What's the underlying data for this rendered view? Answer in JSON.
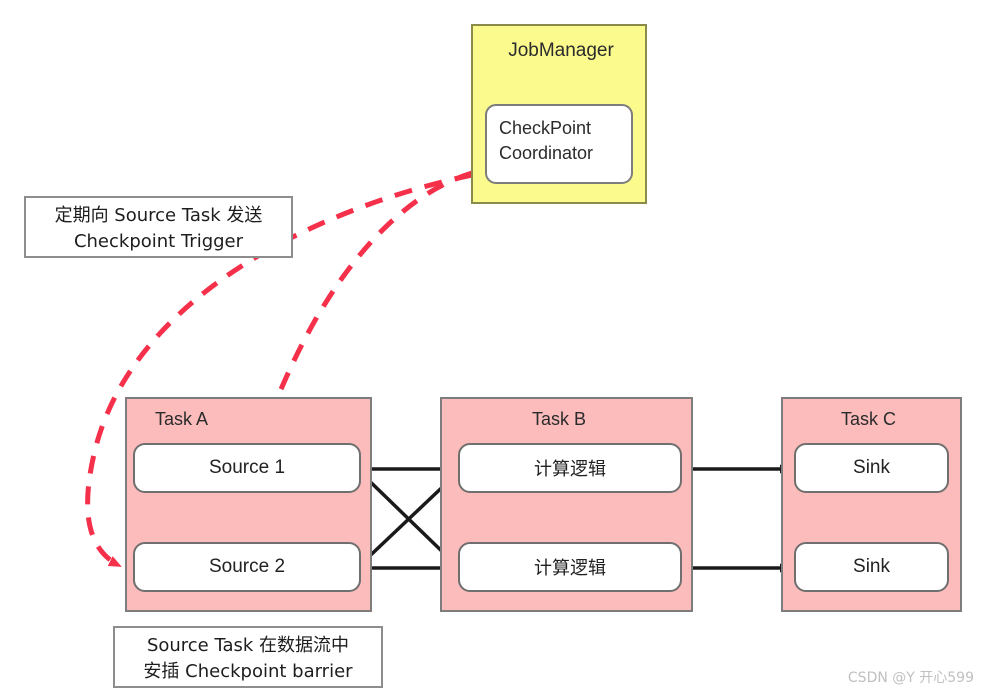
{
  "diagram": {
    "title": "Flink Checkpoint Coordinator dataflow diagram",
    "colors": {
      "jobmanager_fill": "#fbfb8d",
      "jobmanager_stroke": "#8a8a4a",
      "task_fill": "#fcbcbc",
      "task_stroke": "#7d7d7d",
      "operator_fill": "#ffffff",
      "operator_stroke": "#6f6f6f",
      "trigger_arrow": "#f5304a",
      "data_arrow": "#1a1a1a",
      "note_stroke": "#8d8d8d",
      "watermark": "#c0c0c0"
    }
  },
  "jobmanager": {
    "title": "JobManager",
    "coordinator": {
      "line1": "CheckPoint",
      "line2": "Coordinator"
    }
  },
  "notes": [
    {
      "id": "trigger-note",
      "line1": "定期向 Source Task 发送",
      "line2": "Checkpoint Trigger"
    },
    {
      "id": "barrier-note",
      "line1": "Source Task 在数据流中",
      "line2": "安插 Checkpoint barrier"
    }
  ],
  "tasks": [
    {
      "id": "task-a",
      "title": "Task A",
      "operators": [
        {
          "label": "Source 1"
        },
        {
          "label": "Source 2"
        }
      ]
    },
    {
      "id": "task-b",
      "title": "Task B",
      "operators": [
        {
          "label": "计算逻辑"
        },
        {
          "label": "计算逻辑"
        }
      ]
    },
    {
      "id": "task-c",
      "title": "Task C",
      "operators": [
        {
          "label": "Sink"
        },
        {
          "label": "Sink"
        }
      ]
    }
  ],
  "connections": {
    "trigger_arrows": [
      {
        "from": "checkpoint-coordinator",
        "to": "source-1",
        "style": "dashed",
        "color": "#f5304a"
      },
      {
        "from": "checkpoint-coordinator",
        "to": "source-2",
        "style": "dashed",
        "color": "#f5304a"
      }
    ],
    "data_arrows": [
      {
        "from": "source-1",
        "to": "task-b-operator-1",
        "style": "solid"
      },
      {
        "from": "source-1",
        "to": "task-b-operator-2",
        "style": "solid"
      },
      {
        "from": "source-2",
        "to": "task-b-operator-1",
        "style": "solid"
      },
      {
        "from": "source-2",
        "to": "task-b-operator-2",
        "style": "solid"
      },
      {
        "from": "task-b-operator-1",
        "to": "sink-1",
        "style": "solid"
      },
      {
        "from": "task-b-operator-2",
        "to": "sink-2",
        "style": "solid"
      }
    ]
  },
  "watermark": {
    "text": "CSDN @Y 开心599"
  }
}
